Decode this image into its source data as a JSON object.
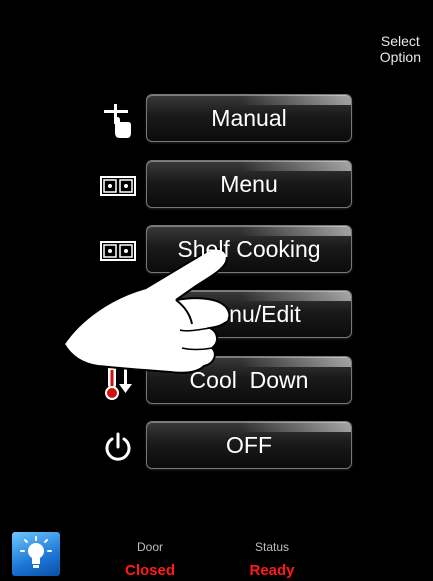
{
  "header": {
    "select_label_line1": "Select",
    "select_label_line2": "Option"
  },
  "menu": [
    {
      "label": "Manual",
      "icon": "manual-touch-icon"
    },
    {
      "label": "Menu",
      "icon": "menu-grid-icon"
    },
    {
      "label": "Shelf Cooking",
      "icon": "shelf-grid-icon"
    },
    {
      "label": "Menu/Edit",
      "icon": "edit-icon"
    },
    {
      "label": "Cool  Down",
      "icon": "thermometer-down-icon"
    },
    {
      "label": "OFF",
      "icon": "power-icon"
    }
  ],
  "footer": {
    "door_label": "Door",
    "door_value": "Closed",
    "status_label": "Status",
    "status_value": "Ready",
    "light_icon": "light-bulb-icon"
  },
  "colors": {
    "background": "#000000",
    "status_value": "#ff1b1b",
    "light_button": "#1b77d6"
  }
}
